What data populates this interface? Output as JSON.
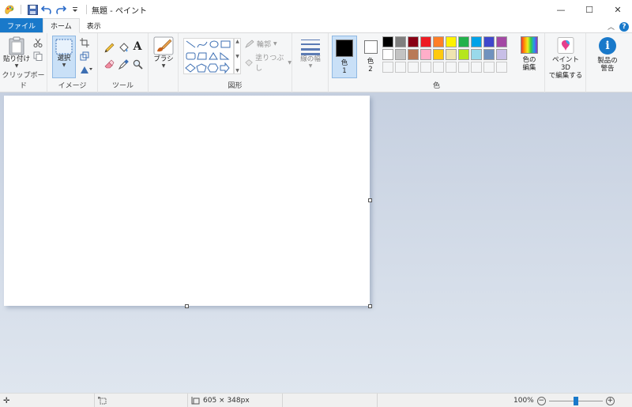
{
  "window": {
    "title": "無題 - ペイント",
    "minimize": "—",
    "maximize": "☐",
    "close": "✕"
  },
  "tabs": [
    {
      "label": "ファイル"
    },
    {
      "label": "ホーム"
    },
    {
      "label": "表示"
    }
  ],
  "clipboard": {
    "paste_label": "貼り付け",
    "group_label": "クリップボード"
  },
  "image": {
    "select_label": "選択",
    "group_label": "イメージ"
  },
  "tools": {
    "group_label": "ツール",
    "text_tool": "A"
  },
  "brushes": {
    "label": "ブラシ"
  },
  "shapes": {
    "outline_label": "輪郭",
    "fill_label": "塗りつぶし",
    "group_label": "図形"
  },
  "size": {
    "label": "線の幅"
  },
  "colors": {
    "color1_label": "色",
    "color1_num": "1",
    "color2_label": "色",
    "color2_num": "2",
    "edit_label_1": "色の",
    "edit_label_2": "編集",
    "group_label": "色",
    "color1_value": "#000000",
    "color2_value": "#ffffff",
    "palette_row1": [
      "#000000",
      "#7f7f7f",
      "#880015",
      "#ed1c24",
      "#ff7f27",
      "#fff200",
      "#22b14c",
      "#00a2e8",
      "#3f48cc",
      "#a349a4"
    ],
    "palette_row2": [
      "#ffffff",
      "#c3c3c3",
      "#b97a57",
      "#ffaec9",
      "#ffc90e",
      "#efe4b0",
      "#b5e61d",
      "#99d9ea",
      "#7092be",
      "#c8bfe7"
    ]
  },
  "paint3d": {
    "label_1": "ペイント 3D",
    "label_2": "で編集する"
  },
  "product_alert": {
    "label_1": "製品の",
    "label_2": "警告"
  },
  "status": {
    "dimensions": "605 × 348px",
    "zoom": "100%",
    "zoom_level": 0.5
  }
}
